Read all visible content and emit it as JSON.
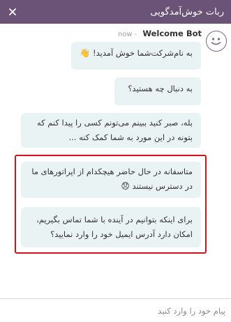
{
  "header": {
    "title": "ربات خوش‌آمدگویی",
    "background": "#6b5377"
  },
  "sender": {
    "name": "Welcome Bot",
    "time": "now -"
  },
  "messages": [
    {
      "lines": [
        "به نام‌شرکت‌شما خوش آمدید!"
      ],
      "emoji": "👋"
    },
    {
      "lines": [
        "به دنبال چه هستید؟"
      ]
    },
    {
      "lines": [
        "بله، صبر کنید ببینم می‌تونم کسی را پیدا کنم که",
        "بتونه در این مورد به شما کمک کنه ..."
      ]
    },
    {
      "lines": [
        "متاسفانه در حال حاضر هیچکدام از اپراتورهای ما",
        "در دسترس نیستند"
      ],
      "emoji": "😞"
    },
    {
      "lines": [
        "برای اینکه بتوانیم در آینده با شما تماس بگیریم،",
        "امکان دارد آدرس ایمیل خود را وارد نمایید؟"
      ]
    }
  ],
  "input": {
    "placeholder": "پیام خود را وارد کنید"
  },
  "colors": {
    "bubble": "#e9f3f4",
    "highlight": "#d4111b"
  }
}
